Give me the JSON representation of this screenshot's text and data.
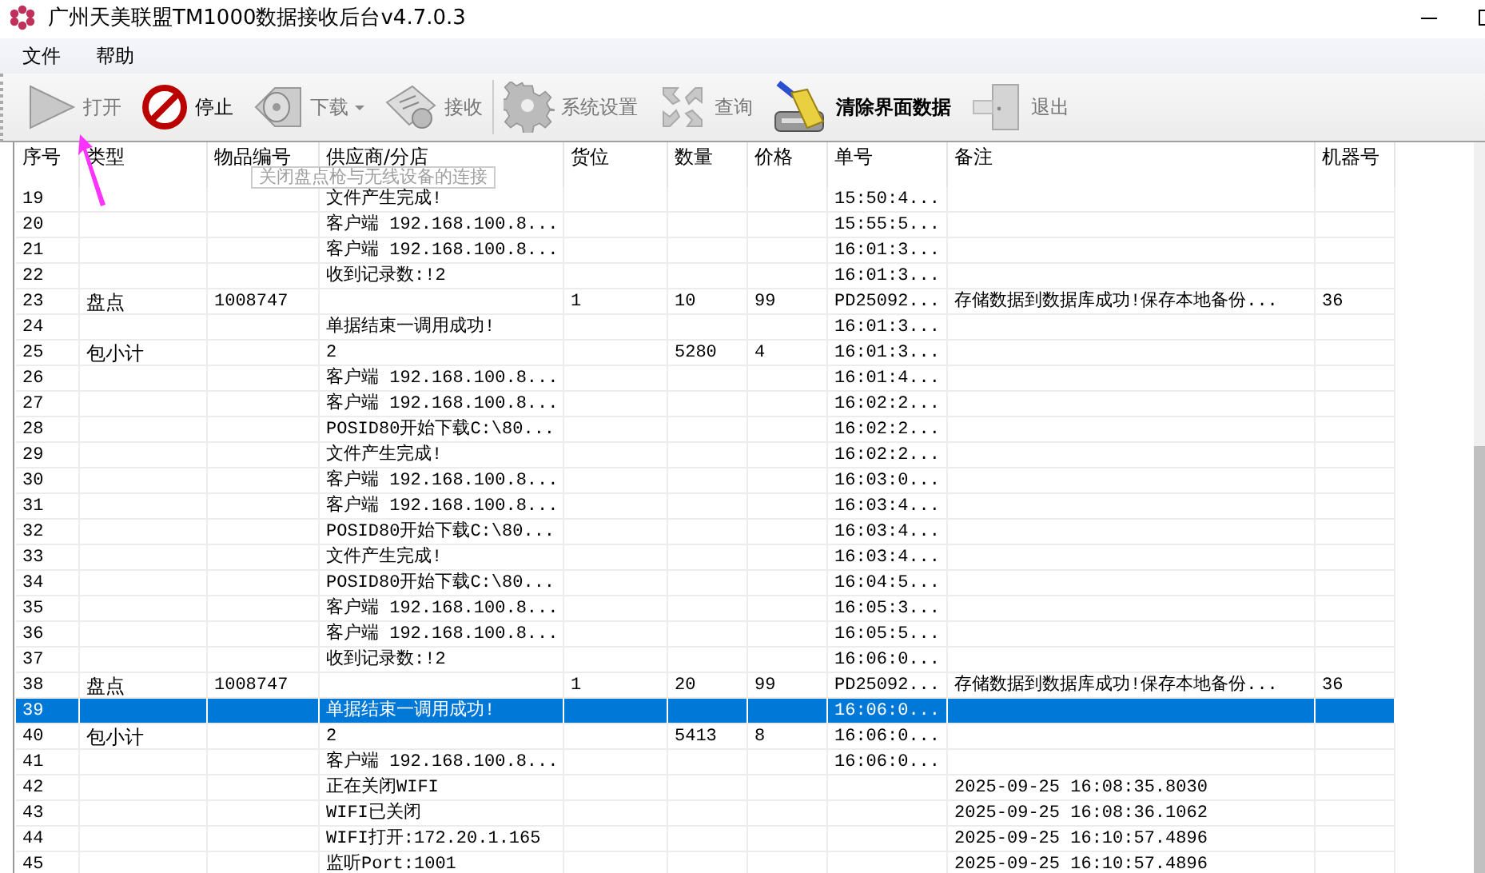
{
  "window": {
    "title": "广州天美联盟TM1000数据接收后台v4.7.0.3"
  },
  "menu": [
    {
      "label": "文件"
    },
    {
      "label": "帮助"
    }
  ],
  "toolbar": {
    "groups": [
      [
        {
          "label": "打开",
          "kind": "play",
          "disabled": true
        },
        {
          "label": "停止",
          "kind": "stop",
          "disabled": false
        },
        {
          "label": "下载",
          "kind": "disc",
          "disabled": true,
          "dropdown": true
        },
        {
          "label": "接收",
          "kind": "scanner",
          "disabled": true
        }
      ],
      [
        {
          "label": "系统设置",
          "kind": "gear",
          "disabled": true
        },
        {
          "label": "查询",
          "kind": "refresh",
          "disabled": true
        },
        {
          "label": "清除界面数据",
          "kind": "broom",
          "disabled": false
        },
        {
          "label": "退出",
          "kind": "door",
          "disabled": true
        }
      ]
    ]
  },
  "tooltip": {
    "text": "关闭盘点枪与无线设备的连接"
  },
  "table": {
    "columns": [
      "序号",
      "类型",
      "物品编号",
      "供应商/分店",
      "货位",
      "数量",
      "价格",
      "单号",
      "备注",
      "机器号"
    ],
    "rows": [
      {
        "no": "19",
        "supplier": "文件产生完成!",
        "order_no": "15:50:4...",
        "selected": false
      },
      {
        "no": "20",
        "supplier": "客户端 192.168.100.8...",
        "order_no": "15:55:5...",
        "selected": false
      },
      {
        "no": "21",
        "supplier": "客户端 192.168.100.8...",
        "order_no": "16:01:3...",
        "selected": false
      },
      {
        "no": "22",
        "supplier": "收到记录数:!2",
        "order_no": "16:01:3...",
        "selected": false
      },
      {
        "no": "23",
        "type": "盘点",
        "item_code": "1008747",
        "location": "1",
        "qty": "10",
        "price": "99",
        "order_no": "PD25092...",
        "note": "存储数据到数据库成功!保存本地备份...",
        "machine_no": "36",
        "selected": false
      },
      {
        "no": "24",
        "supplier": "单据结束一调用成功!",
        "order_no": "16:01:3...",
        "selected": false
      },
      {
        "no": "25",
        "type": "包小计",
        "supplier": "2",
        "qty": "5280",
        "price": "4",
        "order_no": "16:01:3...",
        "selected": false
      },
      {
        "no": "26",
        "supplier": "客户端 192.168.100.8...",
        "order_no": "16:01:4...",
        "selected": false
      },
      {
        "no": "27",
        "supplier": "客户端 192.168.100.8...",
        "order_no": "16:02:2...",
        "selected": false
      },
      {
        "no": "28",
        "supplier": "POSID80开始下载C:\\80...",
        "order_no": "16:02:2...",
        "selected": false
      },
      {
        "no": "29",
        "supplier": "文件产生完成!",
        "order_no": "16:02:2...",
        "selected": false
      },
      {
        "no": "30",
        "supplier": "客户端 192.168.100.8...",
        "order_no": "16:03:0...",
        "selected": false
      },
      {
        "no": "31",
        "supplier": "客户端 192.168.100.8...",
        "order_no": "16:03:4...",
        "selected": false
      },
      {
        "no": "32",
        "supplier": "POSID80开始下载C:\\80...",
        "order_no": "16:03:4...",
        "selected": false
      },
      {
        "no": "33",
        "supplier": "文件产生完成!",
        "order_no": "16:03:4...",
        "selected": false
      },
      {
        "no": "34",
        "supplier": "POSID80开始下载C:\\80...",
        "order_no": "16:04:5...",
        "selected": false
      },
      {
        "no": "35",
        "supplier": "客户端 192.168.100.8...",
        "order_no": "16:05:3...",
        "selected": false
      },
      {
        "no": "36",
        "supplier": "客户端 192.168.100.8...",
        "order_no": "16:05:5...",
        "selected": false
      },
      {
        "no": "37",
        "supplier": "收到记录数:!2",
        "order_no": "16:06:0...",
        "selected": false
      },
      {
        "no": "38",
        "type": "盘点",
        "item_code": "1008747",
        "location": "1",
        "qty": "20",
        "price": "99",
        "order_no": "PD25092...",
        "note": "存储数据到数据库成功!保存本地备份...",
        "machine_no": "36",
        "selected": false
      },
      {
        "no": "39",
        "supplier": "单据结束一调用成功!",
        "order_no": "16:06:0...",
        "selected": true
      },
      {
        "no": "40",
        "type": "包小计",
        "supplier": "2",
        "qty": "5413",
        "price": "8",
        "order_no": "16:06:0...",
        "selected": false
      },
      {
        "no": "41",
        "supplier": "客户端 192.168.100.8...",
        "order_no": "16:06:0...",
        "selected": false
      },
      {
        "no": "42",
        "supplier": "正在关闭WIFI",
        "note": "2025-09-25 16:08:35.8030",
        "selected": false
      },
      {
        "no": "43",
        "supplier": "WIFI已关闭",
        "note": "2025-09-25 16:08:36.1062",
        "selected": false
      },
      {
        "no": "44",
        "supplier": "WIFI打开:172.20.1.165",
        "note": "2025-09-25 16:10:57.4896",
        "selected": false
      },
      {
        "no": "45",
        "supplier": "监听Port:1001",
        "note": "2025-09-25 16:10:57.4896",
        "selected": false
      }
    ]
  }
}
